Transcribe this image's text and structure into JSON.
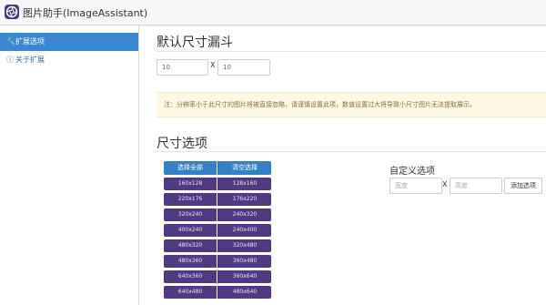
{
  "app": {
    "title": "图片助手(ImageAssistant)",
    "logo_icon": "camera-aperture-icon"
  },
  "sidebar": {
    "items": [
      {
        "icon": "wrench-icon",
        "glyph": "🔧",
        "label": "扩展选项",
        "active": true
      },
      {
        "icon": "info-circle-icon",
        "glyph": "ⓘ",
        "label": "关于扩展",
        "active": false
      }
    ]
  },
  "default_size": {
    "title": "默认尺寸漏斗",
    "width_value": "10",
    "height_value": "10",
    "separator": "X"
  },
  "notice": {
    "text": "注：分辨率小于此尺寸的图片将被直接忽略，请谨慎设置此项，数值设置过大将导致小尺寸图片无法提取展示。"
  },
  "size_options": {
    "title": "尺寸选项",
    "select_all_label": "选择全部",
    "clear_label": "清空选择",
    "rows": [
      {
        "left": "160x128",
        "right": "128x160"
      },
      {
        "left": "220x176",
        "right": "176x220"
      },
      {
        "left": "320x240",
        "right": "240x320"
      },
      {
        "left": "400x240",
        "right": "240x400"
      },
      {
        "left": "480x320",
        "right": "320x480"
      },
      {
        "left": "480x360",
        "right": "360x480"
      },
      {
        "left": "640x360",
        "right": "360x640"
      },
      {
        "left": "640x480",
        "right": "480x640"
      }
    ]
  },
  "custom": {
    "title": "自定义选项",
    "width_placeholder": "宽度",
    "height_placeholder": "高度",
    "separator": "X",
    "add_label": "添加选项"
  },
  "colors": {
    "accent_blue": "#3b87d1",
    "size_button_purple": "#4f3a83",
    "notice_bg": "#fcf8e3",
    "notice_text": "#8a6d3b"
  }
}
